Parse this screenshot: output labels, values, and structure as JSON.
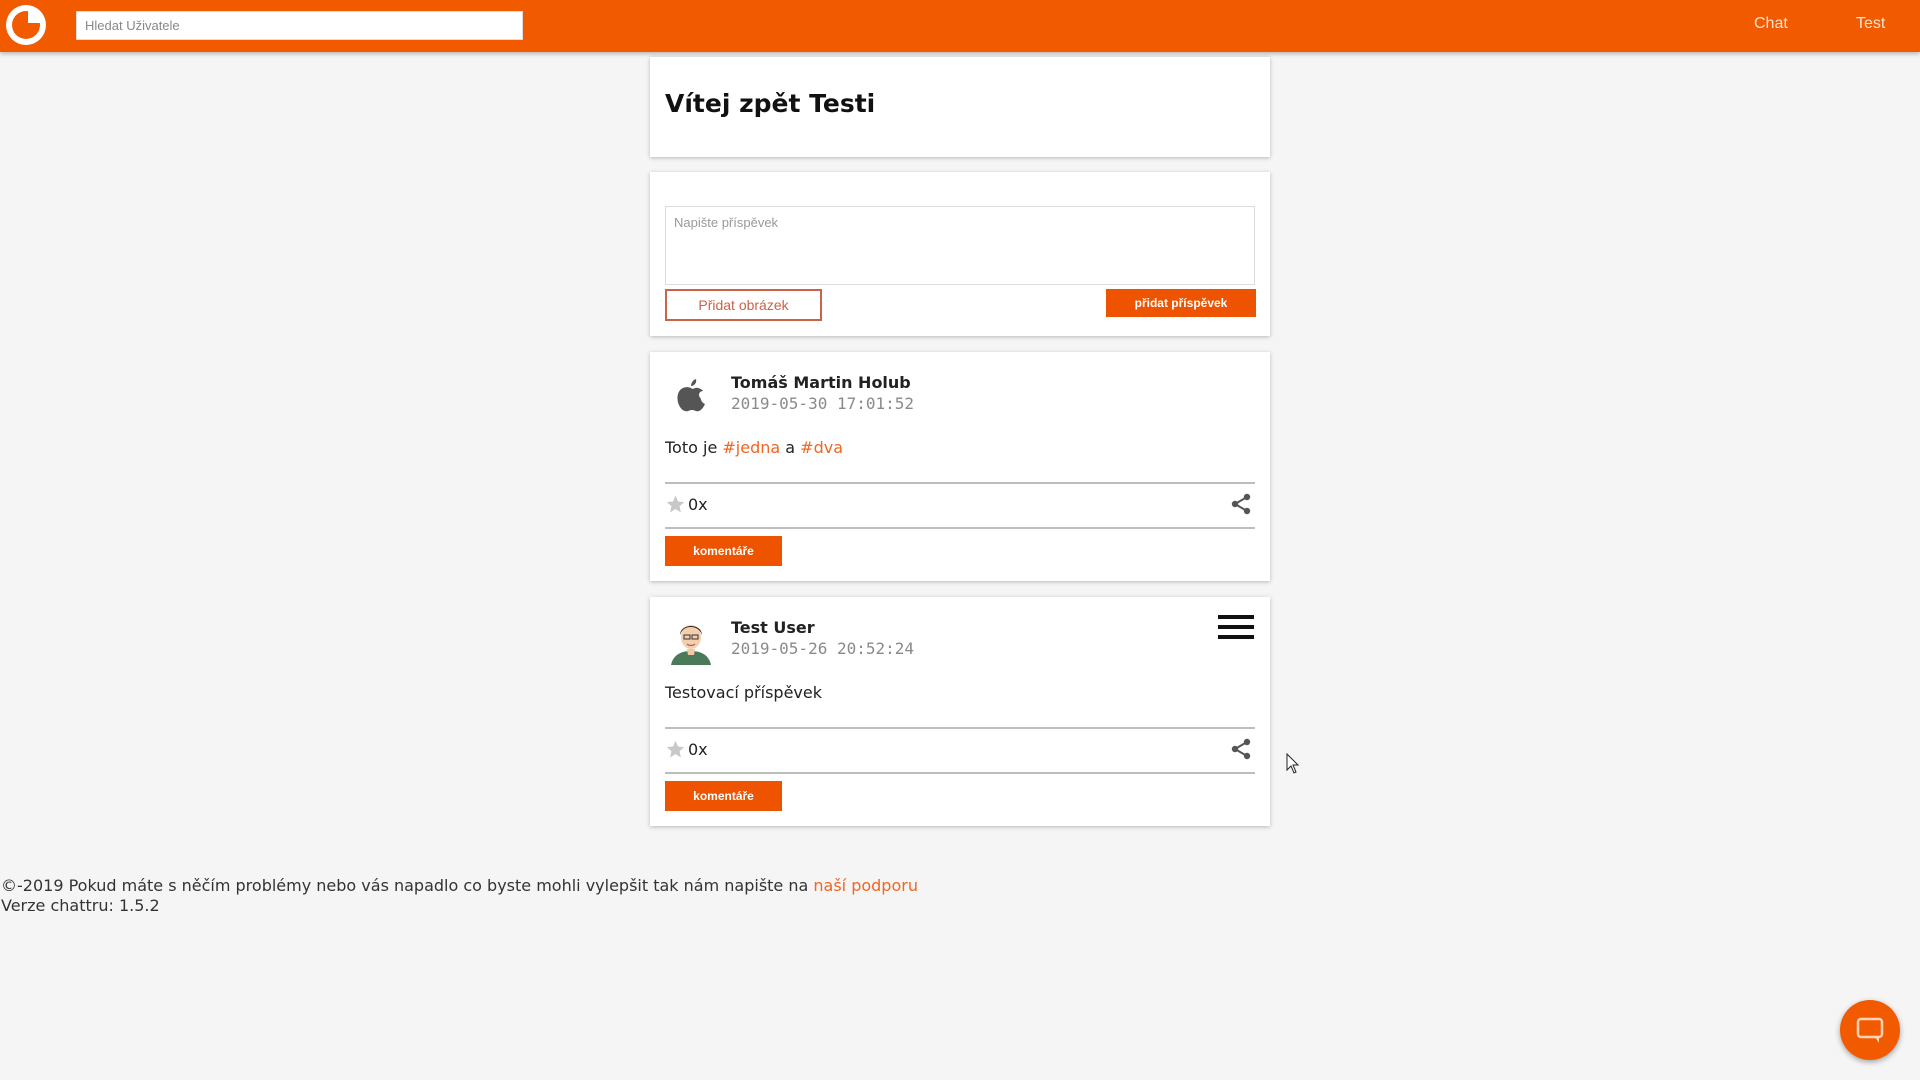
{
  "header": {
    "search_placeholder": "Hledat Uživatele",
    "nav": [
      {
        "label": "Chat"
      },
      {
        "label": "Test"
      }
    ]
  },
  "welcome": {
    "title": "Vítej zpět Testi"
  },
  "composer": {
    "placeholder": "Napište příspěvek",
    "add_image_label": "Přidat obrázek",
    "add_post_label": "přidat příspěvek"
  },
  "posts": [
    {
      "author": "Tomáš Martin Holub",
      "timestamp": "2019-05-30 17:01:52",
      "text_before": "Toto je ",
      "hashtag_1": "#jedna",
      "text_mid": " a ",
      "hashtag_2": "#dva",
      "likes": "0x",
      "comments_label": "komentáře",
      "avatar_icon": "apple-logo-icon"
    },
    {
      "author": "Test User",
      "timestamp": "2019-05-26 20:52:24",
      "text": "Testovací příspěvek",
      "likes": "0x",
      "comments_label": "komentáře",
      "avatar_icon": "user-avatar-icon"
    }
  ],
  "footer": {
    "copyright_text": "©-2019 Pokud máte s něčím problémy nebo vás napadlo co byste mohli vylepšit tak nám napište na ",
    "support_link": "naší podporu",
    "version_text": "Verze chattru: 1.5.2"
  },
  "colors": {
    "brand": "#f25a00",
    "button": "#ee5300",
    "link": "#f26522",
    "page_bg": "#f5f5f5"
  }
}
